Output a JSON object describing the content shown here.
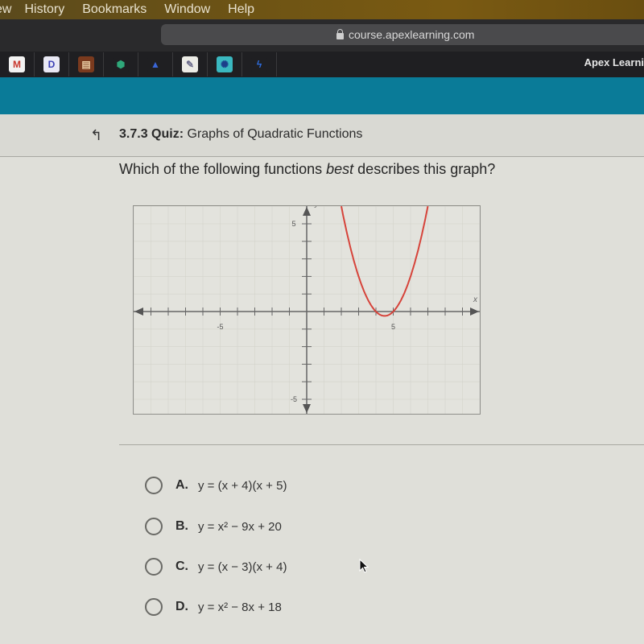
{
  "menubar": {
    "items": [
      "ew",
      "History",
      "Bookmarks",
      "Window",
      "Help"
    ]
  },
  "browser": {
    "url": "course.apexlearning.com",
    "lock_icon": "lock-icon",
    "bookmarks": [
      {
        "name": "gmail-icon",
        "glyph": "M",
        "bg": "#f2f2f2",
        "fg": "#c8372d"
      },
      {
        "name": "disney-icon",
        "glyph": "D",
        "bg": "#e8e8f4",
        "fg": "#3a3fb5"
      },
      {
        "name": "book-app-icon",
        "glyph": "▤",
        "bg": "#7a3a1e",
        "fg": "#e6c8a0"
      },
      {
        "name": "khan-academy-icon",
        "glyph": "⬢",
        "bg": "#1f1f22",
        "fg": "#2fa87a"
      },
      {
        "name": "mountain-icon",
        "glyph": "▲",
        "bg": "#1f1f22",
        "fg": "#3a66d8"
      },
      {
        "name": "script-logo-icon",
        "glyph": "✎",
        "bg": "#ecece6",
        "fg": "#6a6a8a"
      },
      {
        "name": "teal-app-icon",
        "glyph": "✺",
        "bg": "#3ab8c0",
        "fg": "#1b3e8a"
      },
      {
        "name": "stack-logo-icon",
        "glyph": "ϟ",
        "bg": "#1f1f22",
        "fg": "#2e6de0"
      }
    ],
    "tab_title": "Apex Learni"
  },
  "quiz": {
    "number": "3.7.3",
    "quiz_label": "Quiz:",
    "title": "Graphs of Quadratic Functions",
    "question_pre": "Which of the following functions ",
    "question_em": "best",
    "question_post": " describes this graph?"
  },
  "graph": {
    "x_label": "x",
    "y_label": "y",
    "x_ticks_labels": [
      "-5",
      "5"
    ],
    "y_ticks_labels": [
      "5",
      "-5"
    ],
    "x_range": [
      -10,
      10
    ],
    "y_range": [
      -6,
      6
    ],
    "curve": {
      "equation": "y = x^2 - 9x + 20",
      "vertex": [
        4.5,
        -0.25
      ],
      "roots": [
        4,
        5
      ],
      "color": "#d6433a"
    }
  },
  "choices": [
    {
      "letter": "A.",
      "expr": "y = (x + 4)(x + 5)"
    },
    {
      "letter": "B.",
      "expr": "y = x² − 9x + 20"
    },
    {
      "letter": "C.",
      "expr": "y = (x − 3)(x + 4)"
    },
    {
      "letter": "D.",
      "expr": "y = x² − 8x + 18"
    }
  ]
}
